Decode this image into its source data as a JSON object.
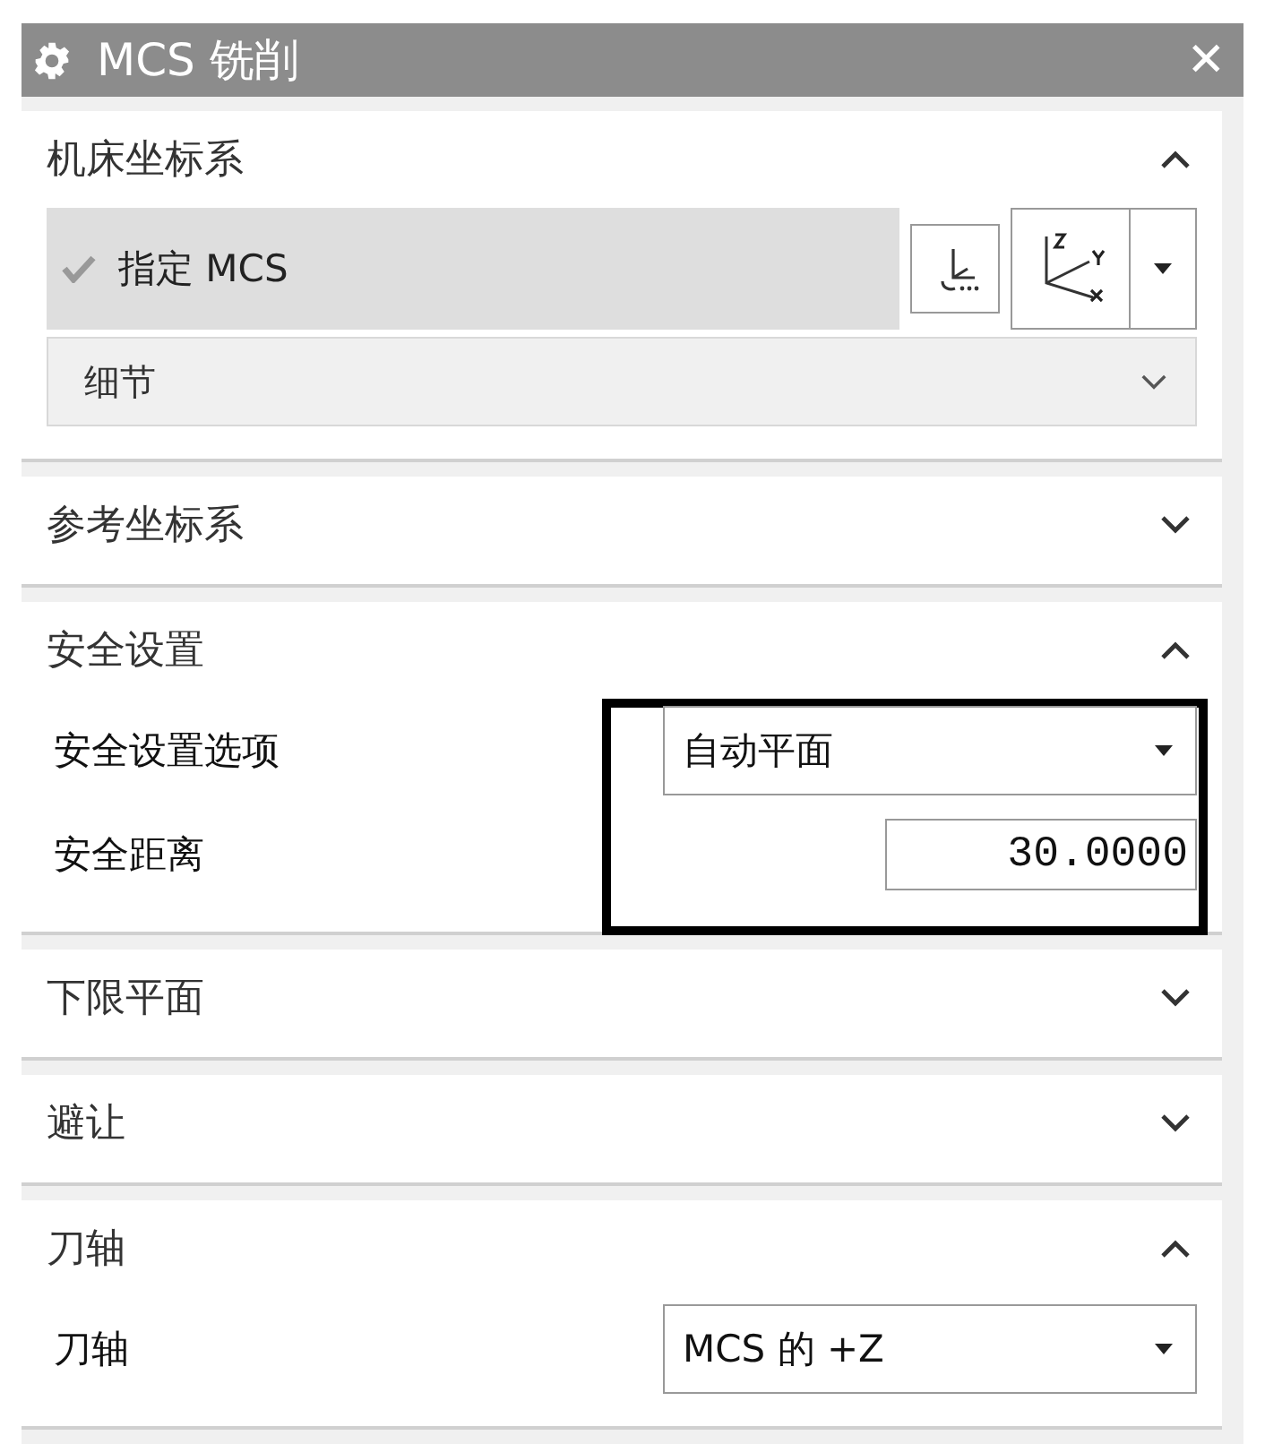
{
  "window": {
    "title": "MCS 铣削",
    "close": "✕"
  },
  "sections": [
    {
      "title": "机床坐标系",
      "expanded": true,
      "kind": "mcs",
      "specify": {
        "label": "指定 MCS",
        "done": true
      },
      "details": {
        "title": "细节",
        "expanded": false
      }
    },
    {
      "title": "参考坐标系",
      "expanded": false
    },
    {
      "title": "安全设置",
      "expanded": true,
      "kind": "fields",
      "highlighted": true,
      "fields": [
        {
          "label": "安全设置选项",
          "kind": "dropdown",
          "value": "自动平面"
        },
        {
          "label": "安全距离",
          "kind": "number",
          "value": "30.0000"
        }
      ]
    },
    {
      "title": "下限平面",
      "expanded": false
    },
    {
      "title": "避让",
      "expanded": false
    },
    {
      "title": "刀轴",
      "expanded": true,
      "kind": "fields",
      "fields": [
        {
          "label": "刀轴",
          "kind": "dropdown",
          "value": "MCS 的 +Z"
        }
      ]
    }
  ]
}
